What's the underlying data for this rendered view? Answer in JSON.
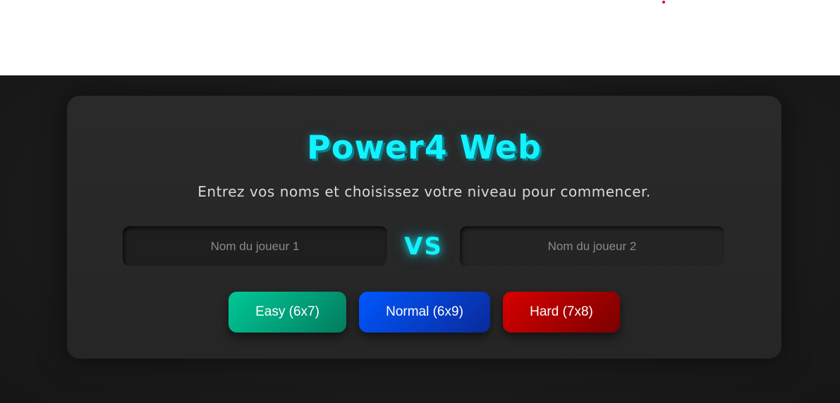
{
  "title": "Power4 Web",
  "subtitle": "Entrez vos noms et choisissez votre niveau pour commencer.",
  "players": {
    "player1_placeholder": "Nom du joueur 1",
    "vs_label": "VS",
    "player2_placeholder": "Nom du joueur 2"
  },
  "difficulties": [
    {
      "label": "Easy (6x7)",
      "color": "#00b386"
    },
    {
      "label": "Normal (6x9)",
      "color": "#0047e0"
    },
    {
      "label": "Hard (7x8)",
      "color": "#c00000"
    }
  ],
  "colors": {
    "accent": "#12f2ff",
    "card_bg": "#282828",
    "page_bg": "#1b1b1b"
  }
}
